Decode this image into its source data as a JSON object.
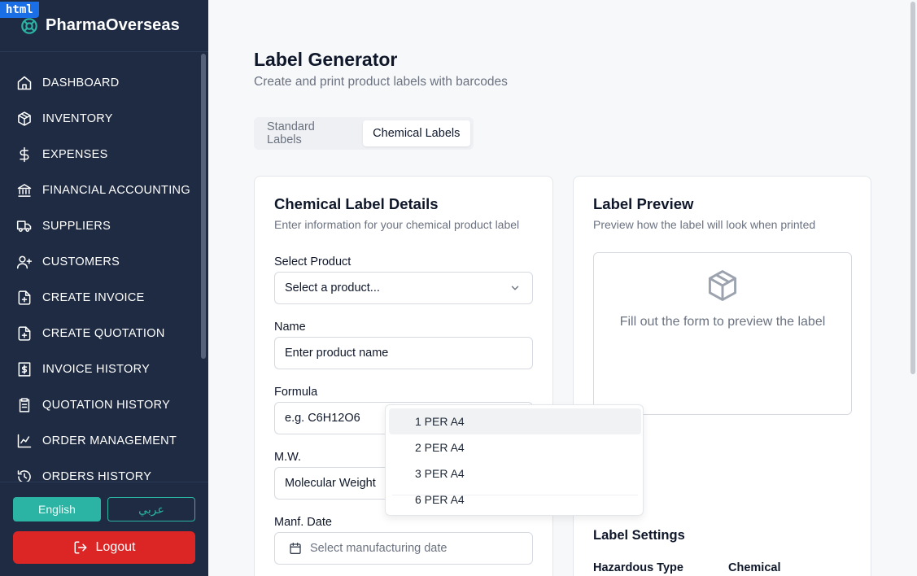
{
  "badge": "html",
  "brand": {
    "name": "PharmaOverseas",
    "logo_icon": "lifebuoy-icon"
  },
  "nav": [
    {
      "label": "DASHBOARD",
      "icon": "home-icon"
    },
    {
      "label": "INVENTORY",
      "icon": "package-icon"
    },
    {
      "label": "EXPENSES",
      "icon": "dollar-icon"
    },
    {
      "label": "FINANCIAL ACCOUNTING",
      "icon": "bank-icon"
    },
    {
      "label": "SUPPLIERS",
      "icon": "truck-icon"
    },
    {
      "label": "CUSTOMERS",
      "icon": "user-plus-icon"
    },
    {
      "label": "CREATE INVOICE",
      "icon": "file-plus-icon"
    },
    {
      "label": "CREATE QUOTATION",
      "icon": "file-plus-icon"
    },
    {
      "label": "INVOICE HISTORY",
      "icon": "file-dollar-icon"
    },
    {
      "label": "QUOTATION HISTORY",
      "icon": "clipboard-icon"
    },
    {
      "label": "ORDER MANAGEMENT",
      "icon": "chart-icon"
    },
    {
      "label": "ORDERS HISTORY",
      "icon": "history-icon"
    }
  ],
  "language": {
    "english": "English",
    "arabic": "عربي"
  },
  "logout": "Logout",
  "page": {
    "title": "Label Generator",
    "subtitle": "Create and print product labels with barcodes"
  },
  "tabs": {
    "standard": "Standard Labels",
    "chemical": "Chemical Labels"
  },
  "details": {
    "title": "Chemical Label Details",
    "subtitle": "Enter information for your chemical product label",
    "product_label": "Select Product",
    "product_value": "Select a product...",
    "name_label": "Name",
    "name_placeholder": "Enter product name",
    "formula_label": "Formula",
    "formula_placeholder": "e.g. C6H12O6",
    "mw_label": "M.W.",
    "mw_placeholder": "Molecular Weight",
    "date_label": "Manf. Date",
    "date_placeholder": "Select manufacturing date"
  },
  "preview": {
    "title": "Label Preview",
    "subtitle": "Preview how the label will look when printed",
    "empty_message": "Fill out the form to preview the label"
  },
  "dropdown": {
    "options": [
      "1 PER A4",
      "2 PER A4",
      "3 PER A4",
      "6 PER A4"
    ]
  },
  "settings": {
    "title": "Label Settings",
    "hazard_label": "Hazardous Type",
    "hazard_value": "Chemical"
  },
  "colors": {
    "sidebar_bg": "#1e2b42",
    "accent": "#2bb3a3",
    "logout": "#dc2626"
  }
}
